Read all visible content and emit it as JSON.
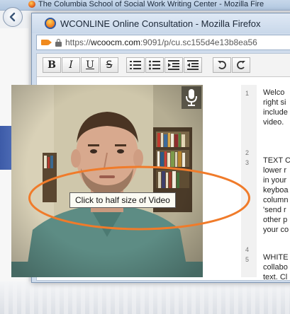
{
  "background_window": {
    "title": "The Columbia School of Social Work Writing Center - Mozilla Fire"
  },
  "popup": {
    "title": "WCONLINE Online Consultation - Mozilla Firefox",
    "url_prefix": "https://",
    "url_domain": "wcoocm.com",
    "url_rest": ":9091/p/cu.sc155d4e13b8ea56"
  },
  "toolbar": {
    "bold": "B",
    "italic": "I",
    "underline": "U",
    "strike": "S"
  },
  "video": {
    "tooltip": "Click to half size of Video"
  },
  "document": {
    "line_numbers": [
      "1",
      "2",
      "3",
      "4",
      "5"
    ],
    "lines": [
      "Welco",
      "right si",
      "include",
      "video.",
      "TEXT C",
      "lower r",
      "in your",
      "keyboa",
      "column",
      "'send r",
      "other p",
      "your co",
      "WHITE",
      "collabo",
      "text. Cl"
    ]
  },
  "colors": {
    "accent_orange": "#f07b2a",
    "titlebar": "#cfdcec"
  }
}
